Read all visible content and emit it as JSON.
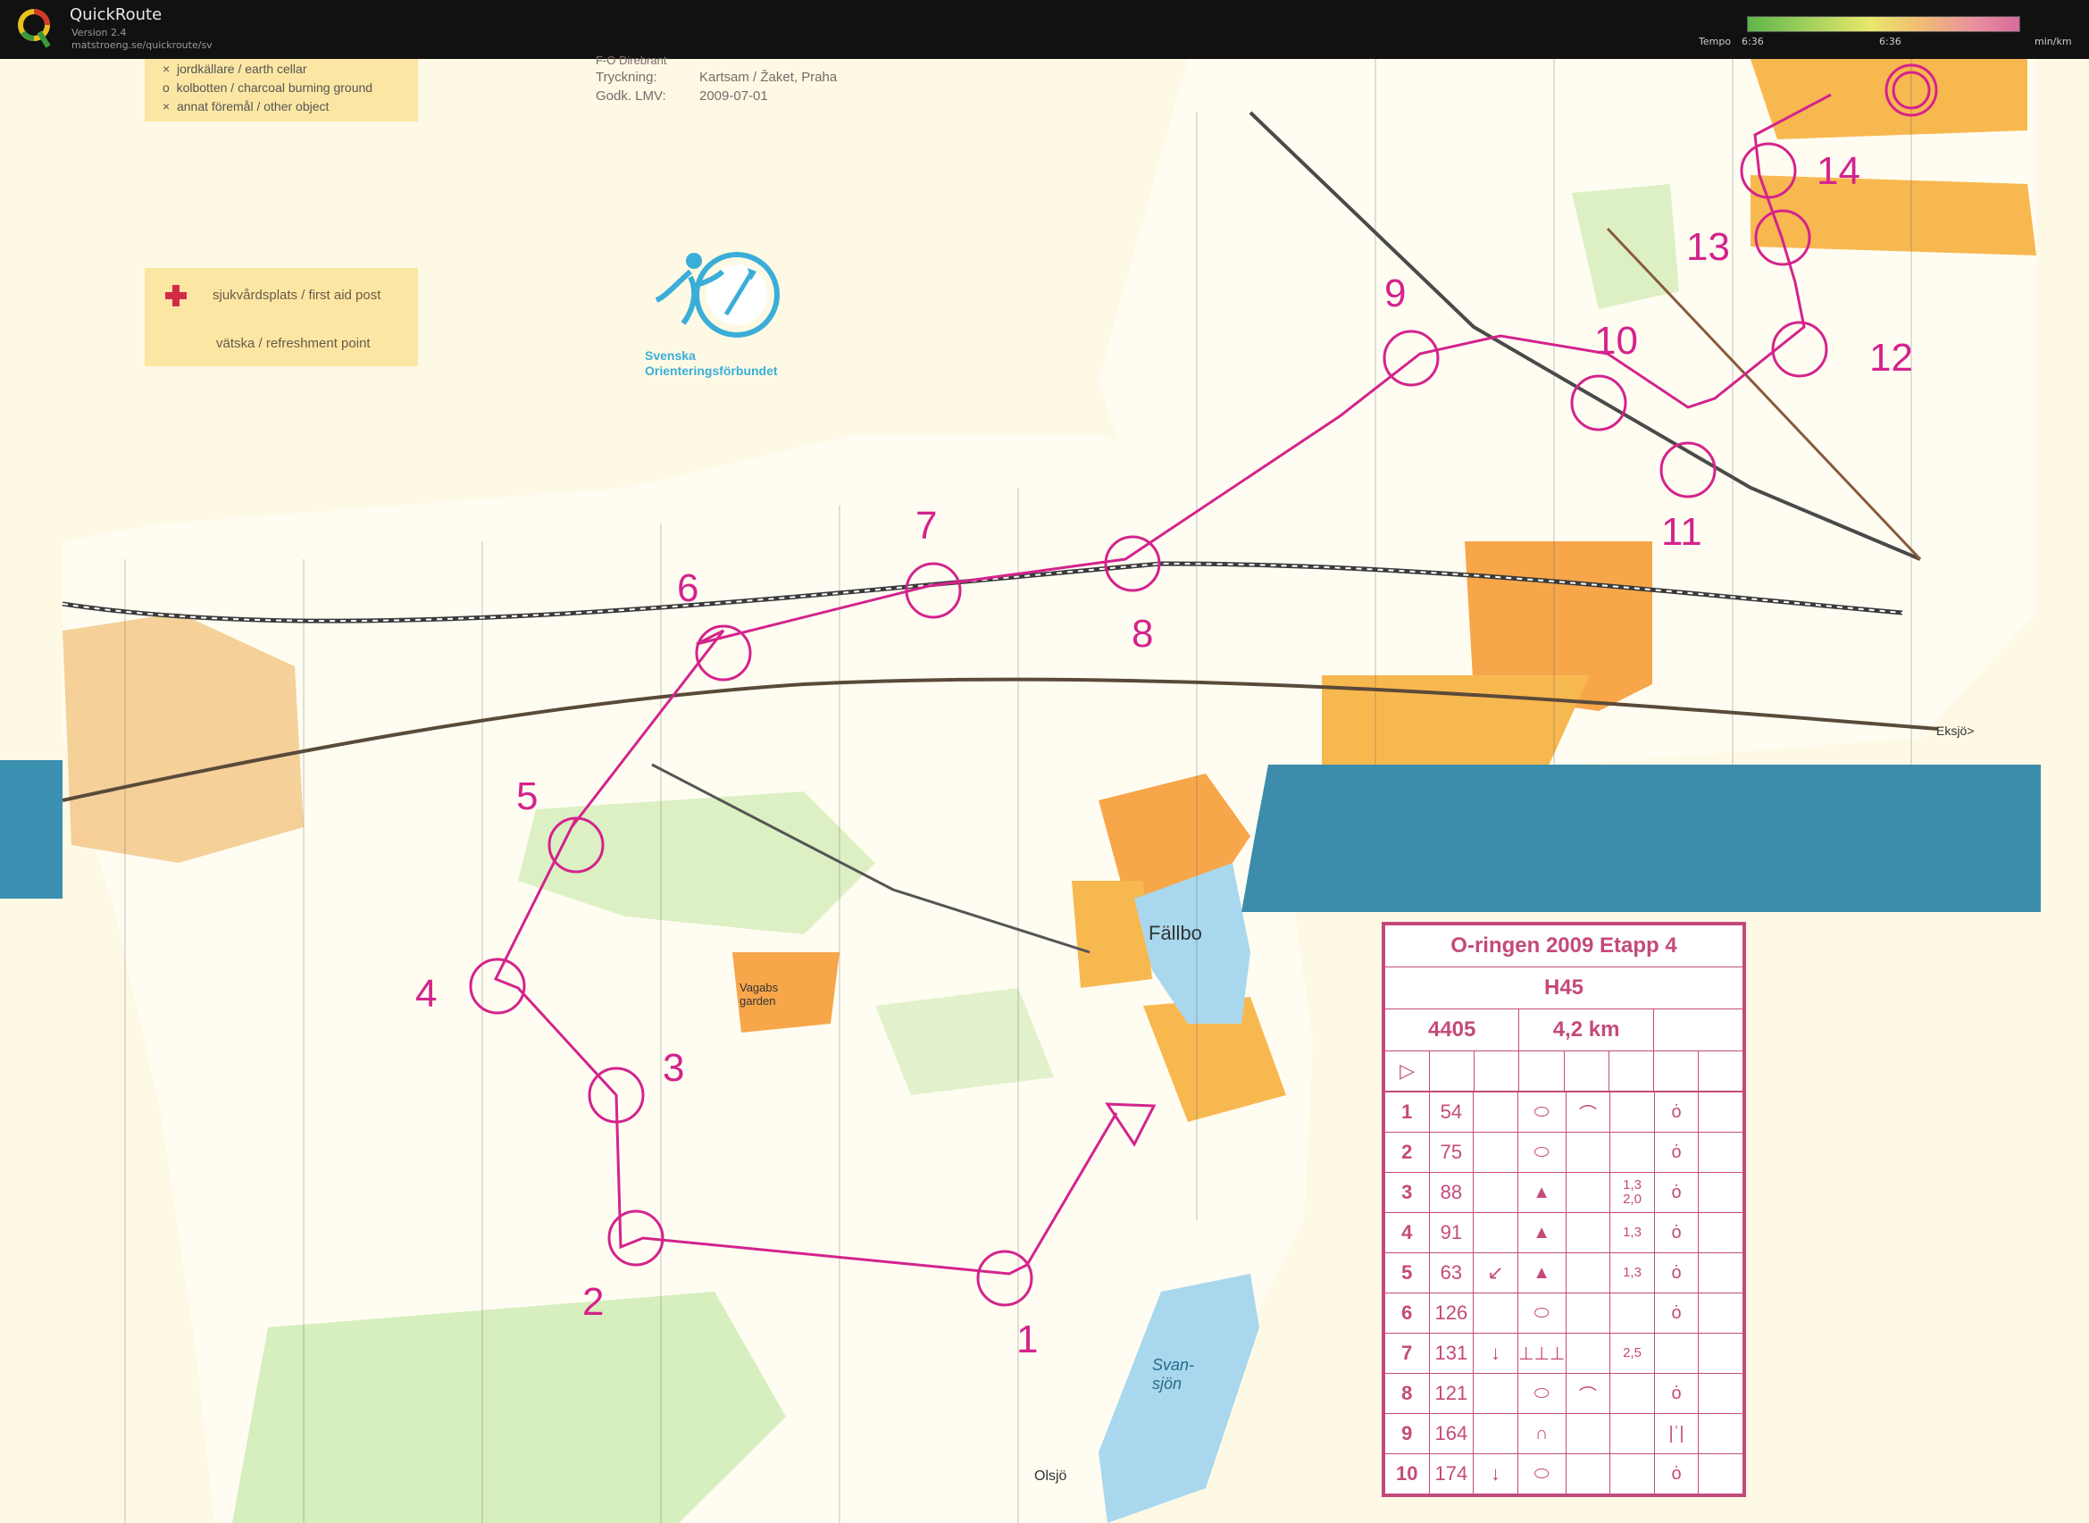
{
  "app": {
    "title": "QuickRoute",
    "version": "Version 2.4",
    "url": "matstroeng.se/quickroute/sv"
  },
  "tempo": {
    "label": "Tempo",
    "left_value": "6:36",
    "mid_value": "6:36",
    "unit": "min/km"
  },
  "legend": {
    "items": [
      {
        "symbol": "×",
        "text": "jordkällare / earth cellar"
      },
      {
        "symbol": "o",
        "text": "kolbotten / charcoal burning ground"
      },
      {
        "symbol": "×",
        "text": "annat föremål / other object"
      }
    ],
    "first_aid": "sjukvårdsplats / first aid post",
    "refreshment": "vätska / refreshment point"
  },
  "print_info": {
    "row1_label": "Tryckning:",
    "row1_value": "Kartsam / Žaket, Praha",
    "row2_label": "Godk. LMV:",
    "row2_value": "2009-07-01",
    "partial": "F-O Direbrant"
  },
  "federation": {
    "line1": "Svenska",
    "line2": "Orienteringsförbundet"
  },
  "places": {
    "fallbo": "Fällbo",
    "svansjon": "Svan-\nsjön",
    "olsjo": "Olsjö",
    "eksjo": "Eksjö>",
    "garden": "Vagabs garden"
  },
  "controls": [
    "1",
    "2",
    "3",
    "4",
    "5",
    "6",
    "7",
    "8",
    "9",
    "10",
    "11",
    "12",
    "13",
    "14"
  ],
  "card": {
    "title": "O-ringen 2009 Etapp 4",
    "class": "H45",
    "code": "4405",
    "length": "4,2 km",
    "start_symbol": "▷",
    "rows": [
      {
        "n": "1",
        "code": "54",
        "dir": "",
        "feat": "⬭",
        "detail": "⌒",
        "dim": "",
        "loc": "ȯ"
      },
      {
        "n": "2",
        "code": "75",
        "dir": "",
        "feat": "⬭",
        "detail": "",
        "dim": "",
        "loc": "ȯ"
      },
      {
        "n": "3",
        "code": "88",
        "dir": "",
        "feat": "▲",
        "detail": "",
        "dim": "1,3\n2,0",
        "loc": "ȯ"
      },
      {
        "n": "4",
        "code": "91",
        "dir": "",
        "feat": "▲",
        "detail": "",
        "dim": "1,3",
        "loc": "ȯ"
      },
      {
        "n": "5",
        "code": "63",
        "dir": "↙",
        "feat": "▲",
        "detail": "",
        "dim": "1,3",
        "loc": "ȯ"
      },
      {
        "n": "6",
        "code": "126",
        "dir": "",
        "feat": "⬭",
        "detail": "",
        "dim": "",
        "loc": "ȯ"
      },
      {
        "n": "7",
        "code": "131",
        "dir": "↓",
        "feat": "⊥⊥⊥",
        "detail": "",
        "dim": "2,5",
        "loc": ""
      },
      {
        "n": "8",
        "code": "121",
        "dir": "",
        "feat": "⬭",
        "detail": "⌒",
        "dim": "",
        "loc": "ȯ"
      },
      {
        "n": "9",
        "code": "164",
        "dir": "",
        "feat": "∩",
        "detail": "",
        "dim": "",
        "loc": "|ˈ|"
      },
      {
        "n": "10",
        "code": "174",
        "dir": "↓",
        "feat": "⬭",
        "detail": "",
        "dim": "",
        "loc": "ȯ"
      }
    ]
  }
}
